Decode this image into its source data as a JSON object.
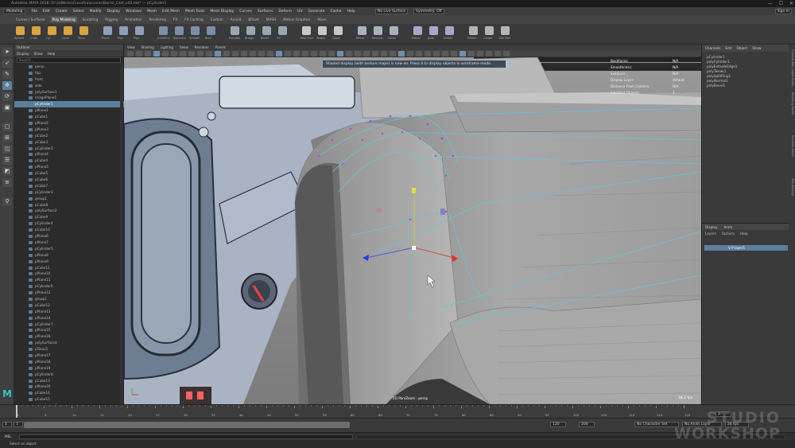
{
  "titlebar": {
    "text": "Autodesk MAYA 2018: D:\\3dWorks\\Crossfire\\scenes\\Barrel_Cast_v02.mb* --- pCylinder1",
    "controls": {
      "minimize": "—",
      "maximize": "☐",
      "close": "✕"
    }
  },
  "menubar": {
    "mode": "Modeling",
    "items": [
      "File",
      "Edit",
      "Create",
      "Select",
      "Modify",
      "Display",
      "Windows",
      "Mesh",
      "Edit Mesh",
      "Mesh Tools",
      "Mesh Display",
      "Curves",
      "Surfaces",
      "Deform",
      "UV",
      "Generate",
      "Cache",
      "Help"
    ],
    "live_surface": "No Live Surface",
    "symmetry": "Symmetry: Off",
    "sign_in": "Sign In"
  },
  "shelf_tabs": {
    "items": [
      "Curves / Surfaces",
      "Poly Modeling",
      "Sculpting",
      "Rigging",
      "Animation",
      "Rendering",
      "FX",
      "FX Caching",
      "Custom",
      "Arnold",
      "Bifrost",
      "MASH",
      "Motion Graphics",
      "XGen"
    ],
    "active": "Poly Modeling"
  },
  "shelf": {
    "buttons": [
      {
        "label": "Sphere",
        "color": "#d9a441"
      },
      {
        "label": "Cube",
        "color": "#d9a441"
      },
      {
        "label": "Cyl",
        "color": "#d9a441"
      },
      {
        "label": "Cone",
        "color": "#d9a441"
      },
      {
        "label": "Torus",
        "color": "#d9a441"
      },
      {
        "label": "Plane",
        "color": "#8ea0b5"
      },
      {
        "label": "Disc",
        "color": "#8ea0b5"
      },
      {
        "label": "Pipe",
        "color": "#8ea0b5"
      },
      {
        "label": "Combine",
        "color": "#7b8fa8"
      },
      {
        "label": "Separate",
        "color": "#7b8fa8"
      },
      {
        "label": "Smooth",
        "color": "#7b8fa8"
      },
      {
        "label": "Bool",
        "color": "#7b8fa8"
      },
      {
        "label": "Extrude",
        "color": "#9aa6b4"
      },
      {
        "label": "Bridge",
        "color": "#9aa6b4"
      },
      {
        "label": "Bevel",
        "color": "#9aa6b4"
      },
      {
        "label": "Fill",
        "color": "#9aa6b4"
      },
      {
        "label": "Multi-Cut",
        "color": "#c8c8c8"
      },
      {
        "label": "Target",
        "color": "#c8c8c8"
      },
      {
        "label": "Quad",
        "color": "#c8c8c8"
      },
      {
        "label": "Mirror",
        "color": "#a6b2c0"
      },
      {
        "label": "Reduce",
        "color": "#a6b2c0"
      },
      {
        "label": "Clean",
        "color": "#a6b2c0"
      },
      {
        "label": "Planar",
        "color": "#b0a3c8"
      },
      {
        "label": "Auto",
        "color": "#b0a3c8"
      },
      {
        "label": "Unfold",
        "color": "#b0a3c8"
      },
      {
        "label": "Freeze",
        "color": "#b5b5b5"
      },
      {
        "label": "Center",
        "color": "#b5b5b5"
      },
      {
        "label": "Del Hist",
        "color": "#b5b5b5"
      }
    ]
  },
  "toolbox": {
    "tools": [
      {
        "name": "select-tool-icon",
        "glyph": "➤"
      },
      {
        "name": "lasso-tool-icon",
        "glyph": "➶"
      },
      {
        "name": "paint-tool-icon",
        "glyph": "✎"
      },
      {
        "name": "move-tool-icon",
        "glyph": "✥"
      },
      {
        "name": "rotate-tool-icon",
        "glyph": "⟳"
      },
      {
        "name": "scale-tool-icon",
        "glyph": "▣"
      },
      {
        "name": "layout-single-icon",
        "glyph": "▢"
      },
      {
        "name": "layout-four-icon",
        "glyph": "⊞"
      },
      {
        "name": "layout-side-icon",
        "glyph": "◫"
      },
      {
        "name": "layout-stack-icon",
        "glyph": "☰"
      },
      {
        "name": "layout-persp-icon",
        "glyph": "◩"
      },
      {
        "name": "outliner-icon",
        "glyph": "≡"
      },
      {
        "name": "search-icon",
        "glyph": "⚲"
      }
    ],
    "maya_logo": "M"
  },
  "outliner": {
    "header": "Outliner",
    "menu": [
      "Display",
      "Show",
      "Help"
    ],
    "search_placeholder": "Search...",
    "items": [
      "persp",
      "top",
      "front",
      "side",
      "polySurface1",
      "imagePlane1",
      "pCylinder1",
      "pPlane1",
      "pCube1",
      "pPlane2",
      "pPlane3",
      "pCube2",
      "pCube3",
      "pCylinder2",
      "pPlane4",
      "pCube4",
      "pPlane5",
      "pCube5",
      "pCube6",
      "pCube7",
      "pCylinder3",
      "group1",
      "pCube8",
      "polySurface2",
      "pCube9",
      "pCylinder4",
      "pCube10",
      "pPlane6",
      "pPlane7",
      "pCylinder5",
      "pPlane8",
      "pPlane9",
      "pCube11",
      "pPlane10",
      "pPlane11",
      "pCylinder6",
      "pPlane12",
      "group2",
      "pCube12",
      "pPlane13",
      "pPlane14",
      "pCylinder7",
      "pPlane15",
      "pPlane16",
      "polySurface3",
      "pTorus1",
      "pPlane17",
      "pPlane18",
      "pPlane19",
      "pCylinder8",
      "pCube13",
      "pPlane20",
      "pCube14",
      "pCube15",
      "defaultLightSet",
      "defaultObjectSet"
    ],
    "selected_index": 6
  },
  "viewport": {
    "menu": [
      "View",
      "Shading",
      "Lighting",
      "Show",
      "Renderer",
      "Panels"
    ],
    "hud_message": "Shaded display (with texture maps) is now on. Press 4 to display objects in wireframe mode.",
    "hud": [
      {
        "k": "Backfaces:",
        "v": "N/A"
      },
      {
        "k": "Smoothness:",
        "v": "N/A"
      },
      {
        "k": "Instance:",
        "v": "N/A"
      },
      {
        "k": "Display Layer:",
        "v": "default"
      },
      {
        "k": "Distance From Camera:",
        "v": "N/A"
      },
      {
        "k": "Selected Objects:",
        "v": "1"
      }
    ],
    "camera_label": "2D Pan/Zoom : persp",
    "fps": "18.2 fps",
    "axis_labels": {
      "x": "x",
      "y": "y",
      "z": "z"
    }
  },
  "channelbox": {
    "tabs": [
      "Channels",
      "Edit",
      "Object",
      "Show"
    ],
    "items": [
      "pCylinder1",
      "polyCylinder1",
      "polyExtrudeEdge1",
      "polyTweak1",
      "polySplitRing1",
      "polyNormal1",
      "polyBevel1"
    ]
  },
  "layer_editor": {
    "tabs": [
      "Display",
      "Anim"
    ],
    "menu": [
      "Layers",
      "Options",
      "Help"
    ],
    "layer_name": "V P  layer1"
  },
  "side_tabs": [
    "Channel Box / Layer Editor",
    "Modeling Toolkit",
    "Attribute Editor",
    "Tool Settings"
  ],
  "timeslider": {
    "ticks": [
      "1",
      "5",
      "10",
      "15",
      "20",
      "25",
      "30",
      "35",
      "40",
      "45",
      "50",
      "55",
      "60",
      "65",
      "70",
      "75",
      "80",
      "85",
      "90",
      "95",
      "100",
      "105",
      "110",
      "115",
      "120"
    ],
    "current_frame": "1"
  },
  "rangeslider": {
    "start": "1",
    "inner_start": "1",
    "inner_end": "120",
    "end": "120",
    "end2": "200",
    "no_char_set": "No Character Set",
    "no_anim_layer": "No Anim Layer",
    "fps": "24 fps"
  },
  "cmdline": {
    "label": "MEL"
  },
  "helpline": {
    "text": "Select an object"
  },
  "watermark": {
    "line1": "STUDIO",
    "line2": "WORKSHOP"
  }
}
